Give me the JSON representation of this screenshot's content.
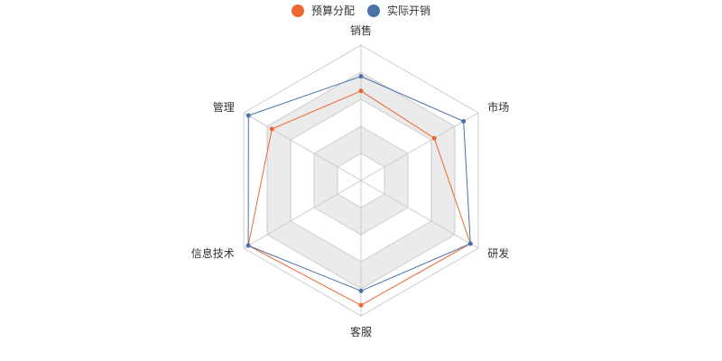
{
  "chart_data": {
    "type": "radar",
    "indicators": [
      {
        "name": "销售",
        "max": 6500
      },
      {
        "name": "市场",
        "max": 16000
      },
      {
        "name": "研发",
        "max": 30000
      },
      {
        "name": "客服",
        "max": 38000
      },
      {
        "name": "信息技术",
        "max": 52000
      },
      {
        "name": "管理",
        "max": 25000
      }
    ],
    "series": [
      {
        "name": "预算分配",
        "color": "#ee6633",
        "values": [
          4300,
          10000,
          28000,
          35000,
          50000,
          19000
        ]
      },
      {
        "name": "实际开销",
        "color": "#4a72a6",
        "values": [
          5000,
          14000,
          28000,
          31000,
          50000,
          24000
        ]
      }
    ],
    "split_number": 5,
    "split_area_colors": [
      "#ffffff",
      "#ebebeb"
    ],
    "legend_position": "top-center"
  }
}
